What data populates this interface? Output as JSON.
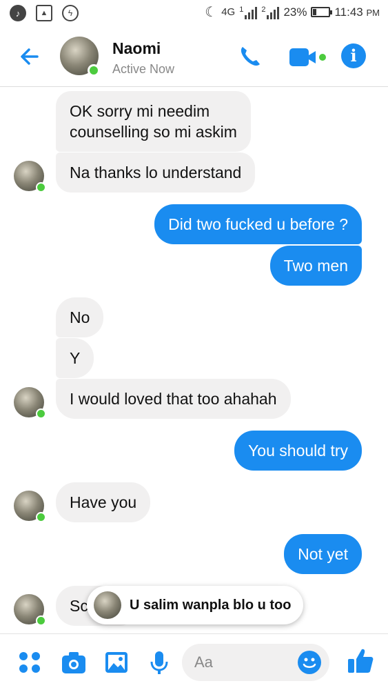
{
  "status_bar": {
    "network": "4G",
    "sim1": "1",
    "sim2": "2",
    "battery": "23%",
    "time": "11:43",
    "ampm": "PM"
  },
  "header": {
    "name": "Naomi",
    "status": "Active Now",
    "accent_color": "#1a8cf0",
    "online_color": "#4ccb3e"
  },
  "messages": [
    {
      "side": "in",
      "text_line1": "OK sorry mi needim",
      "text_line2": "counselling so mi askim"
    },
    {
      "side": "in",
      "text": "Na thanks lo understand"
    },
    {
      "side": "out",
      "text": "Did two fucked u before ?"
    },
    {
      "side": "out",
      "text": "Two men"
    },
    {
      "side": "in",
      "text": "No"
    },
    {
      "side": "in",
      "text": "Y"
    },
    {
      "side": "in",
      "text": "I would loved that too ahahah"
    },
    {
      "side": "out",
      "text": "You should try"
    },
    {
      "side": "in",
      "text": "Have you"
    },
    {
      "side": "out",
      "text": "Not yet"
    },
    {
      "side": "in",
      "text": "Sc"
    }
  ],
  "quick_reply": {
    "text": "U salim wanpla blo u too"
  },
  "composer": {
    "placeholder": "Aa",
    "icons": [
      "grid-icon",
      "camera-icon",
      "image-icon",
      "microphone-icon",
      "emoji-icon",
      "thumbs-up-icon"
    ]
  }
}
